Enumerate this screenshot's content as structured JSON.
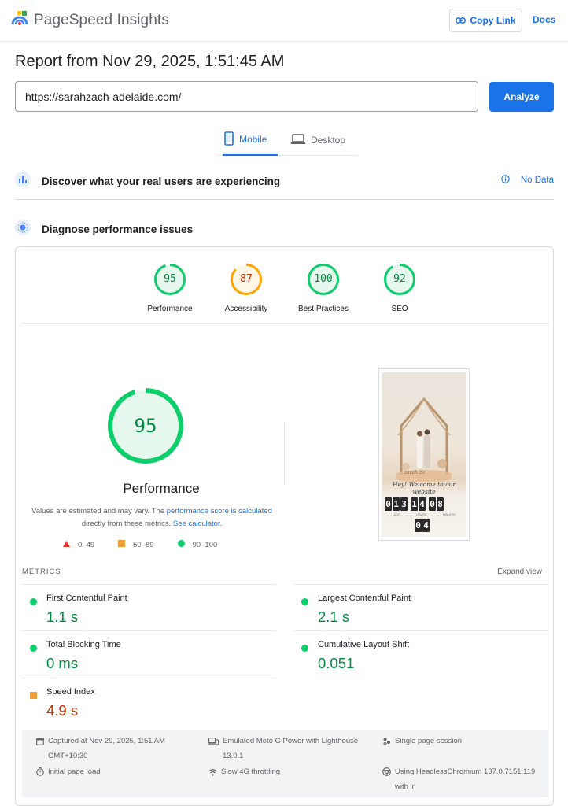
{
  "header": {
    "brand": "PageSpeed Insights",
    "copy_link": "Copy Link",
    "docs": "Docs"
  },
  "report": {
    "title": "Report from Nov 29, 2025, 1:51:45 AM",
    "url": "https://sarahzach-adelaide.com/",
    "analyze": "Analyze"
  },
  "tabs": {
    "mobile": "Mobile",
    "desktop": "Desktop",
    "selected": "Mobile"
  },
  "discover": {
    "title": "Discover what your real users are experiencing",
    "no_data": "No Data"
  },
  "diagnose": {
    "title": "Diagnose performance issues"
  },
  "categories": [
    {
      "label": "Performance",
      "score": "95",
      "status": "good"
    },
    {
      "label": "Accessibility",
      "score": "87",
      "status": "average"
    },
    {
      "label": "Best Practices",
      "score": "100",
      "status": "good"
    },
    {
      "label": "SEO",
      "score": "92",
      "status": "good"
    }
  ],
  "performance": {
    "score": "95",
    "title": "Performance",
    "note_prefix": "Values are estimated and may vary. The",
    "note_link1": "performance score is calculated",
    "note_mid": "directly from these metrics.",
    "note_link2": "See calculator."
  },
  "legend": [
    {
      "range": "0–49",
      "shape": "triangle",
      "color": "#e33b2e"
    },
    {
      "range": "50–89",
      "shape": "square",
      "color": "#f29d3b"
    },
    {
      "range": "90–100",
      "shape": "circle",
      "color": "#0cce6b"
    }
  ],
  "screenshot": {
    "brand_tag": "zarah Sz",
    "welcome": "Hey! Welcome to our website",
    "countdown": [
      "013",
      "14",
      "08"
    ],
    "countdown_caps": [
      "DAYS",
      "HOURS",
      "MINUTES"
    ],
    "countdown_row2": "04"
  },
  "metrics": {
    "label": "METRICS",
    "expand": "Expand view",
    "items": [
      {
        "name": "First Contentful Paint",
        "value": "1.1 s",
        "status": "good"
      },
      {
        "name": "Largest Contentful Paint",
        "value": "2.1 s",
        "status": "good"
      },
      {
        "name": "Total Blocking Time",
        "value": "0 ms",
        "status": "good"
      },
      {
        "name": "Cumulative Layout Shift",
        "value": "0.051",
        "status": "good"
      },
      {
        "name": "Speed Index",
        "value": "4.9 s",
        "status": "average"
      }
    ]
  },
  "meta": {
    "captured": "Captured at Nov 29, 2025, 1:51 AM",
    "captured_tz": "GMT+10:30",
    "page_load": "Initial page load",
    "device": "Emulated Moto G Power with Lighthouse",
    "device_ver": "13.0.1",
    "throttling": "Slow 4G throttling",
    "session": "Single page session",
    "browser": "Using HeadlessChromium 137.0.7151.119",
    "browser2": "with lr"
  },
  "colors": {
    "good": "#0cce6b",
    "good_text": "#008a3e",
    "average": "#ffa400",
    "average_text": "#c33300",
    "accent": "#1a73e8"
  }
}
